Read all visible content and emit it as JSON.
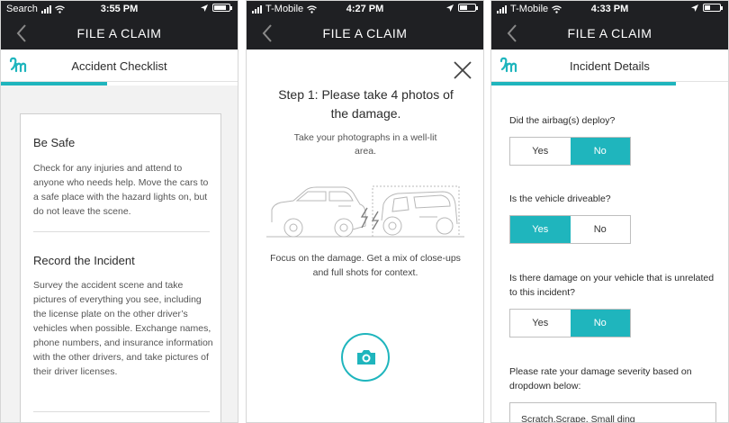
{
  "screens": [
    {
      "status": {
        "carrier": "Search",
        "time": "3:55 PM"
      },
      "nav_title": "FILE A CLAIM",
      "subhead_title": "Accident Checklist",
      "progress": 0.45,
      "sections": [
        {
          "heading": "Be Safe",
          "body": "Check for any injuries and attend to anyone who needs help. Move the cars to a safe place with the hazard lights on, but do not leave the scene."
        },
        {
          "heading": "Record the Incident",
          "body": "Survey the accident scene and take pictures of everything you see, including the license plate on the other driver’s vehicles when possible. Exchange names, phone numbers, and insurance information with the other drivers, and take pictures of their driver licenses."
        }
      ]
    },
    {
      "status": {
        "carrier": "T-Mobile",
        "time": "4:27 PM"
      },
      "nav_title": "FILE A CLAIM",
      "step_title": "Step 1: Please take 4 photos of the damage.",
      "step_sub": "Take your photographs in a well-lit area.",
      "focus_text": "Focus on the damage. Get a mix of close-ups and full shots for context."
    },
    {
      "status": {
        "carrier": "T-Mobile",
        "time": "4:33 PM"
      },
      "nav_title": "FILE A CLAIM",
      "subhead_title": "Incident Details",
      "progress": 0.78,
      "questions": [
        {
          "text": "Did the airbag(s) deploy?",
          "options": [
            "Yes",
            "No"
          ],
          "selected": "No"
        },
        {
          "text": "Is the vehicle driveable?",
          "options": [
            "Yes",
            "No"
          ],
          "selected": "Yes"
        },
        {
          "text": "Is there damage on your vehicle that is unrelated to this incident?",
          "options": [
            "Yes",
            "No"
          ],
          "selected": "No"
        }
      ],
      "severity_label": "Please rate your damage severity based on dropdown below:",
      "severity_value": "Scratch,Scrape, Small ding"
    }
  ],
  "colors": {
    "accent": "#1fb5bd",
    "navbar": "#1f2023"
  },
  "icons": {
    "back": "chevron-left-icon",
    "logo": "metromile-logo-icon",
    "close": "close-icon",
    "camera": "camera-icon",
    "location": "location-arrow-icon"
  }
}
